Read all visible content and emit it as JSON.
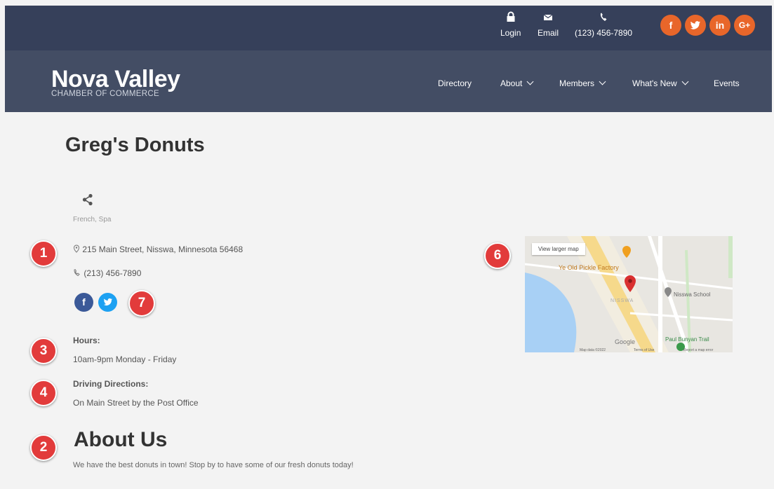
{
  "topbar": {
    "login": "Login",
    "email": "Email",
    "phone": "(123) 456-7890",
    "social": [
      {
        "icon": "facebook-icon",
        "glyph": "f"
      },
      {
        "icon": "twitter-icon",
        "glyph": "t"
      },
      {
        "icon": "linkedin-icon",
        "glyph": "in"
      },
      {
        "icon": "google-plus-icon",
        "glyph": "G+"
      }
    ],
    "accent": "#e8662a"
  },
  "logo": {
    "main": "Nova Valley",
    "sub": "CHAMBER OF COMMERCE"
  },
  "nav": {
    "directory": "Directory",
    "about": "About",
    "members": "Members",
    "whats_new": "What's New",
    "events": "Events"
  },
  "listing": {
    "title": "Greg's Donuts",
    "category": "French, Spa",
    "address": "215 Main Street, Nisswa, Minnesota 56468",
    "phone": "(213) 456-7890",
    "hours_label": "Hours:",
    "hours": "10am-9pm Monday - Friday",
    "directions_label": "Driving Directions:",
    "directions": "On Main Street by the Post Office",
    "about_heading": "About Us",
    "about_text": "We have the best donuts in town! Stop by to have some of our fresh donuts today!"
  },
  "markers": {
    "m1": "1",
    "m2": "2",
    "m3": "3",
    "m4": "4",
    "m6": "6",
    "m7": "7"
  },
  "map": {
    "button": "View larger map",
    "place_factory": "Ye Old Pickle Factory",
    "place_school": "Nisswa School",
    "town": "NISSWA",
    "trail": "Paul Bunyan Trail",
    "brand": "Google",
    "footer_data": "Map data ©2022",
    "footer_terms": "Terms of Use",
    "footer_report": "Report a map error"
  },
  "colors": {
    "header": "#36405a",
    "nav": "#434d64",
    "marker": "#e23b3b",
    "facebook": "#3b5998",
    "twitter": "#1da1f2"
  }
}
